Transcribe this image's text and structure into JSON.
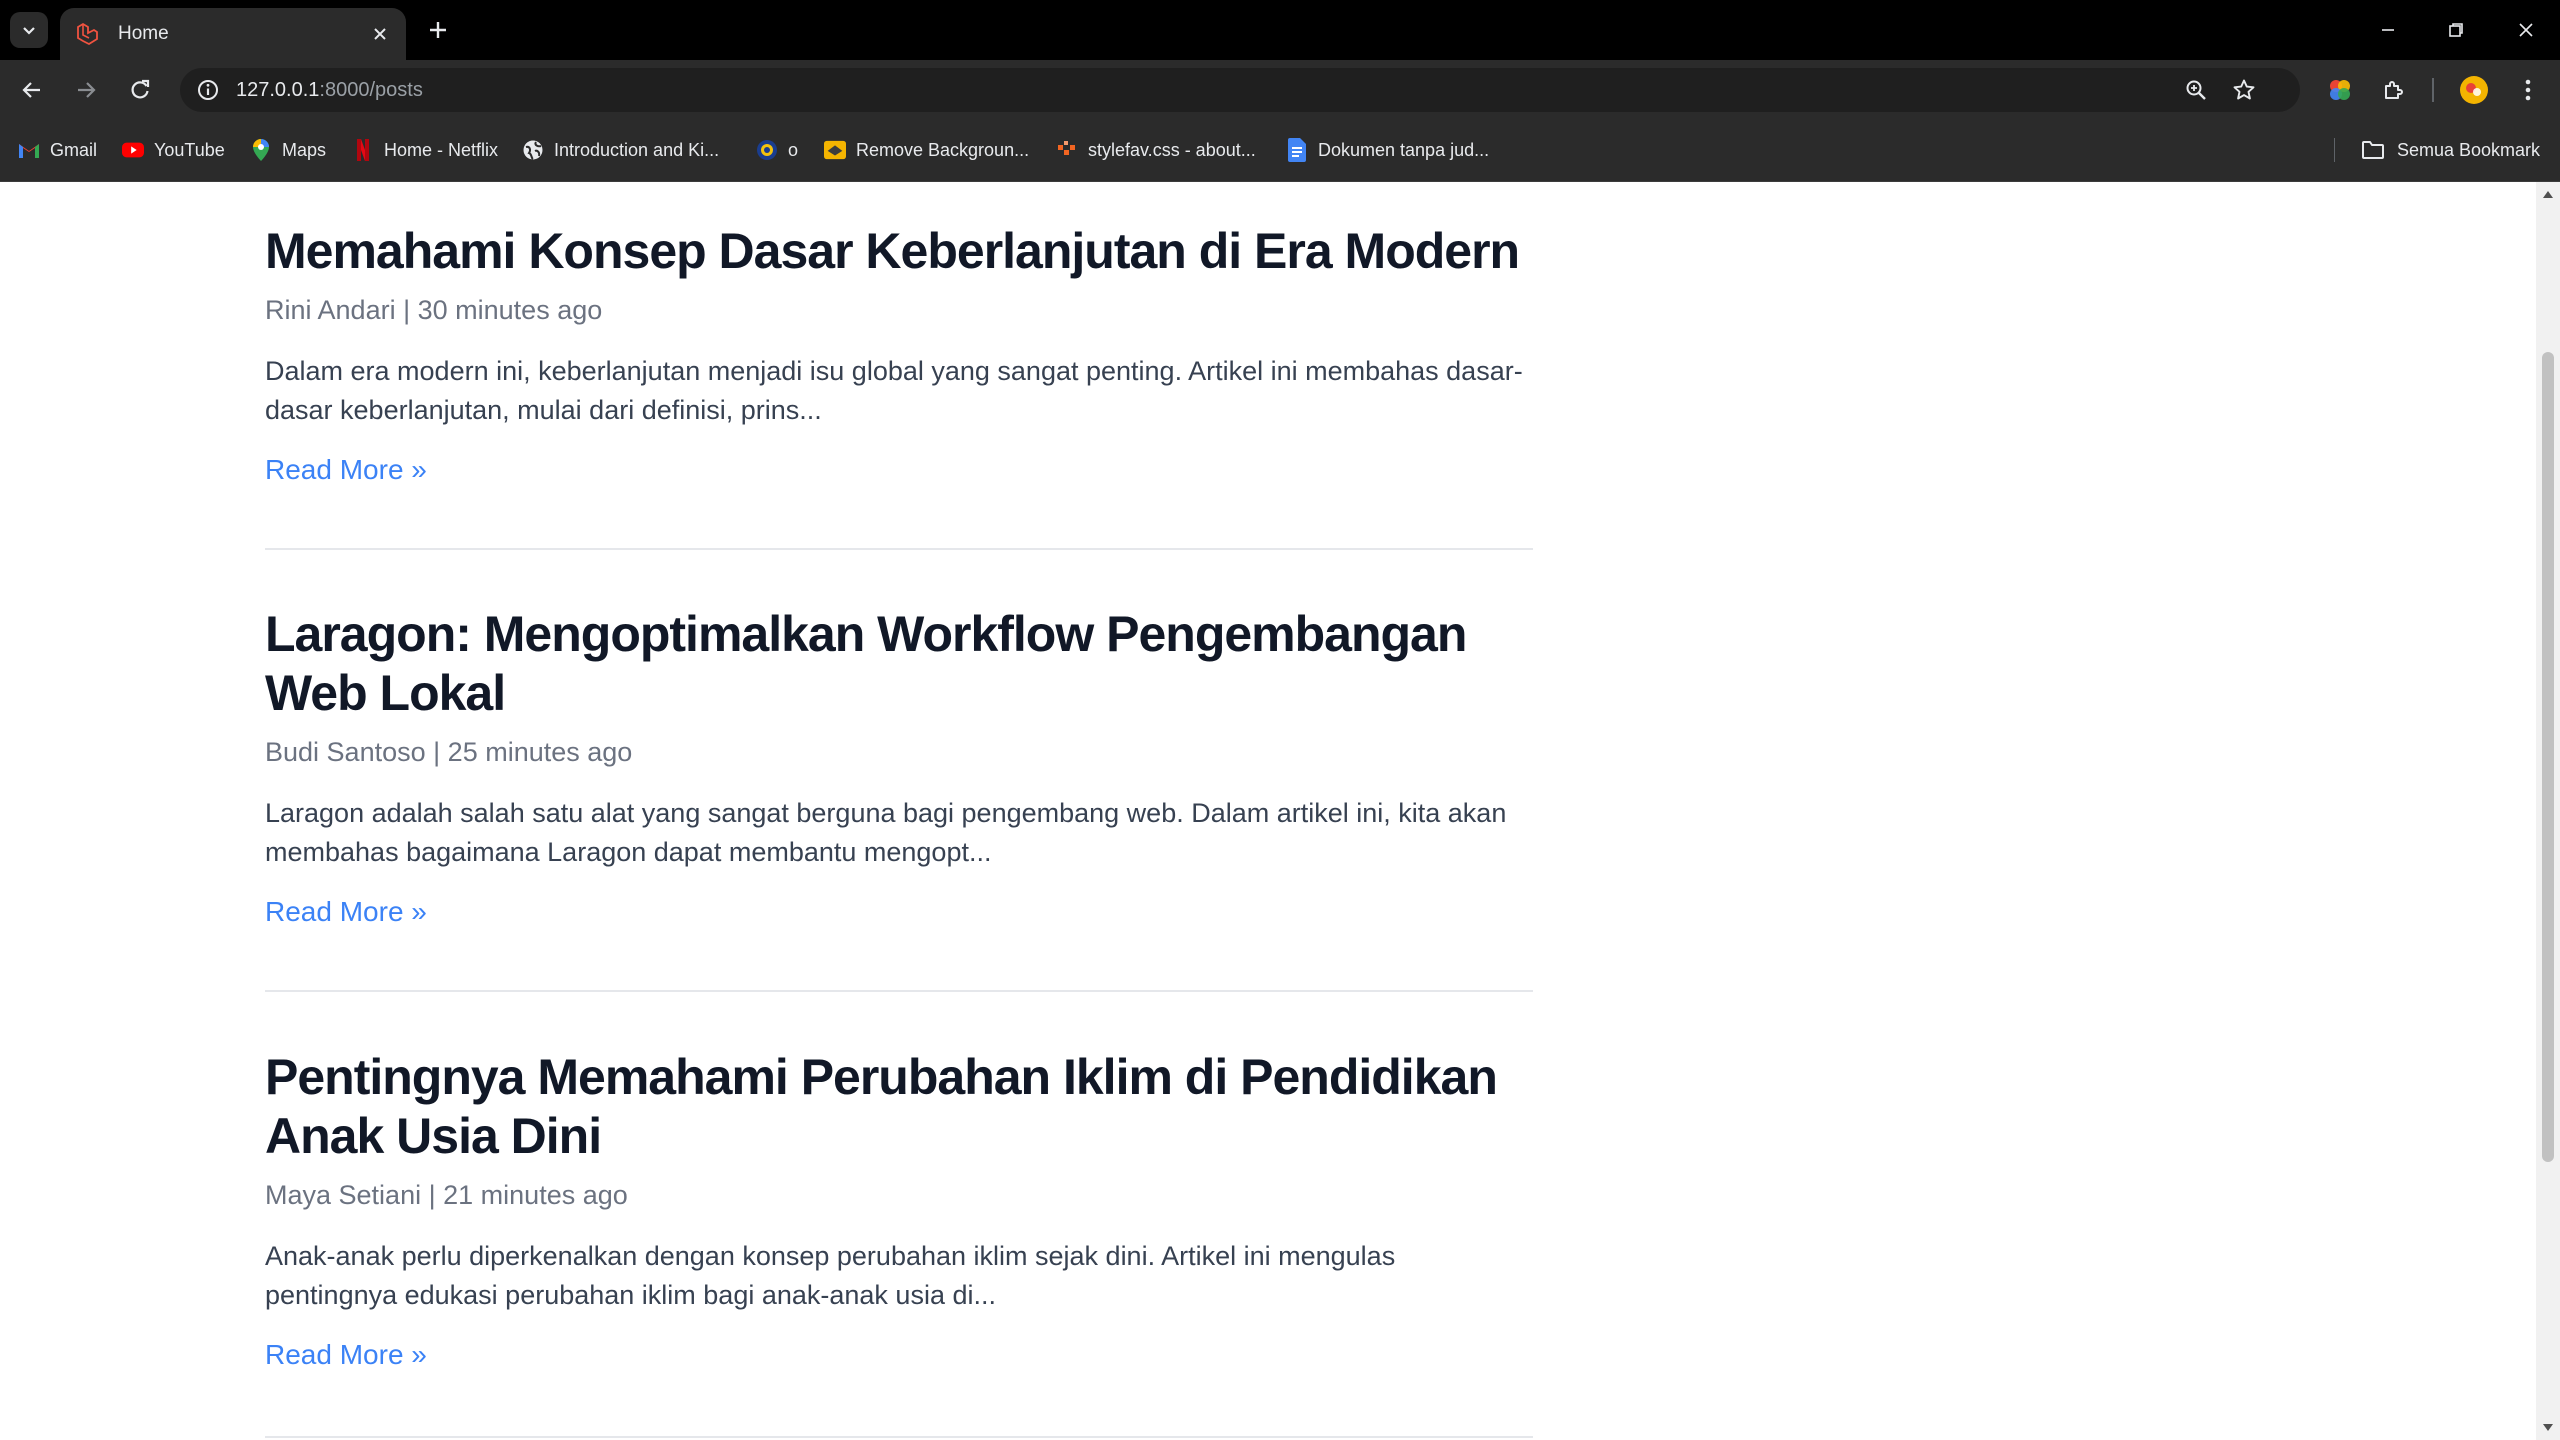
{
  "browser": {
    "tab_title": "Home",
    "url_host": "127.0.0.1",
    "url_path": ":8000/posts",
    "bookmarks": [
      {
        "label": "Gmail",
        "icon": "gmail-icon"
      },
      {
        "label": "YouTube",
        "icon": "youtube-icon"
      },
      {
        "label": "Maps",
        "icon": "maps-icon"
      },
      {
        "label": "Home - Netflix",
        "icon": "netflix-icon"
      },
      {
        "label": "Introduction and Ki...",
        "icon": "globe-icon"
      },
      {
        "label": "o",
        "icon": "badge-icon"
      },
      {
        "label": "Remove Backgroun...",
        "icon": "removebg-icon"
      },
      {
        "label": "stylefav.css - about...",
        "icon": "code-icon"
      },
      {
        "label": "Dokumen tanpa jud...",
        "icon": "docs-icon"
      }
    ],
    "all_bookmarks_label": "Semua Bookmark"
  },
  "posts": [
    {
      "title": "Memahami Konsep Dasar Keberlanjutan di Era Modern",
      "author": "Rini Andari",
      "time": "30 minutes ago",
      "excerpt": "Dalam era modern ini, keberlanjutan menjadi isu global yang sangat penting. Artikel ini membahas dasar-dasar keberlanjutan, mulai dari definisi, prins...",
      "read_more": "Read More »"
    },
    {
      "title": "Laragon: Mengoptimalkan Workflow Pengembangan Web Lokal",
      "author": "Budi Santoso",
      "time": "25 minutes ago",
      "excerpt": "Laragon adalah salah satu alat yang sangat berguna bagi pengembang web. Dalam artikel ini, kita akan membahas bagaimana Laragon dapat membantu mengopt...",
      "read_more": "Read More »"
    },
    {
      "title": "Pentingnya Memahami Perubahan Iklim di Pendidikan Anak Usia Dini",
      "author": "Maya Setiani",
      "time": "21 minutes ago",
      "excerpt": "Anak-anak perlu diperkenalkan dengan konsep perubahan iklim sejak dini. Artikel ini mengulas pentingnya edukasi perubahan iklim bagi anak-anak usia di...",
      "read_more": "Read More »"
    }
  ],
  "meta_separator": "|"
}
